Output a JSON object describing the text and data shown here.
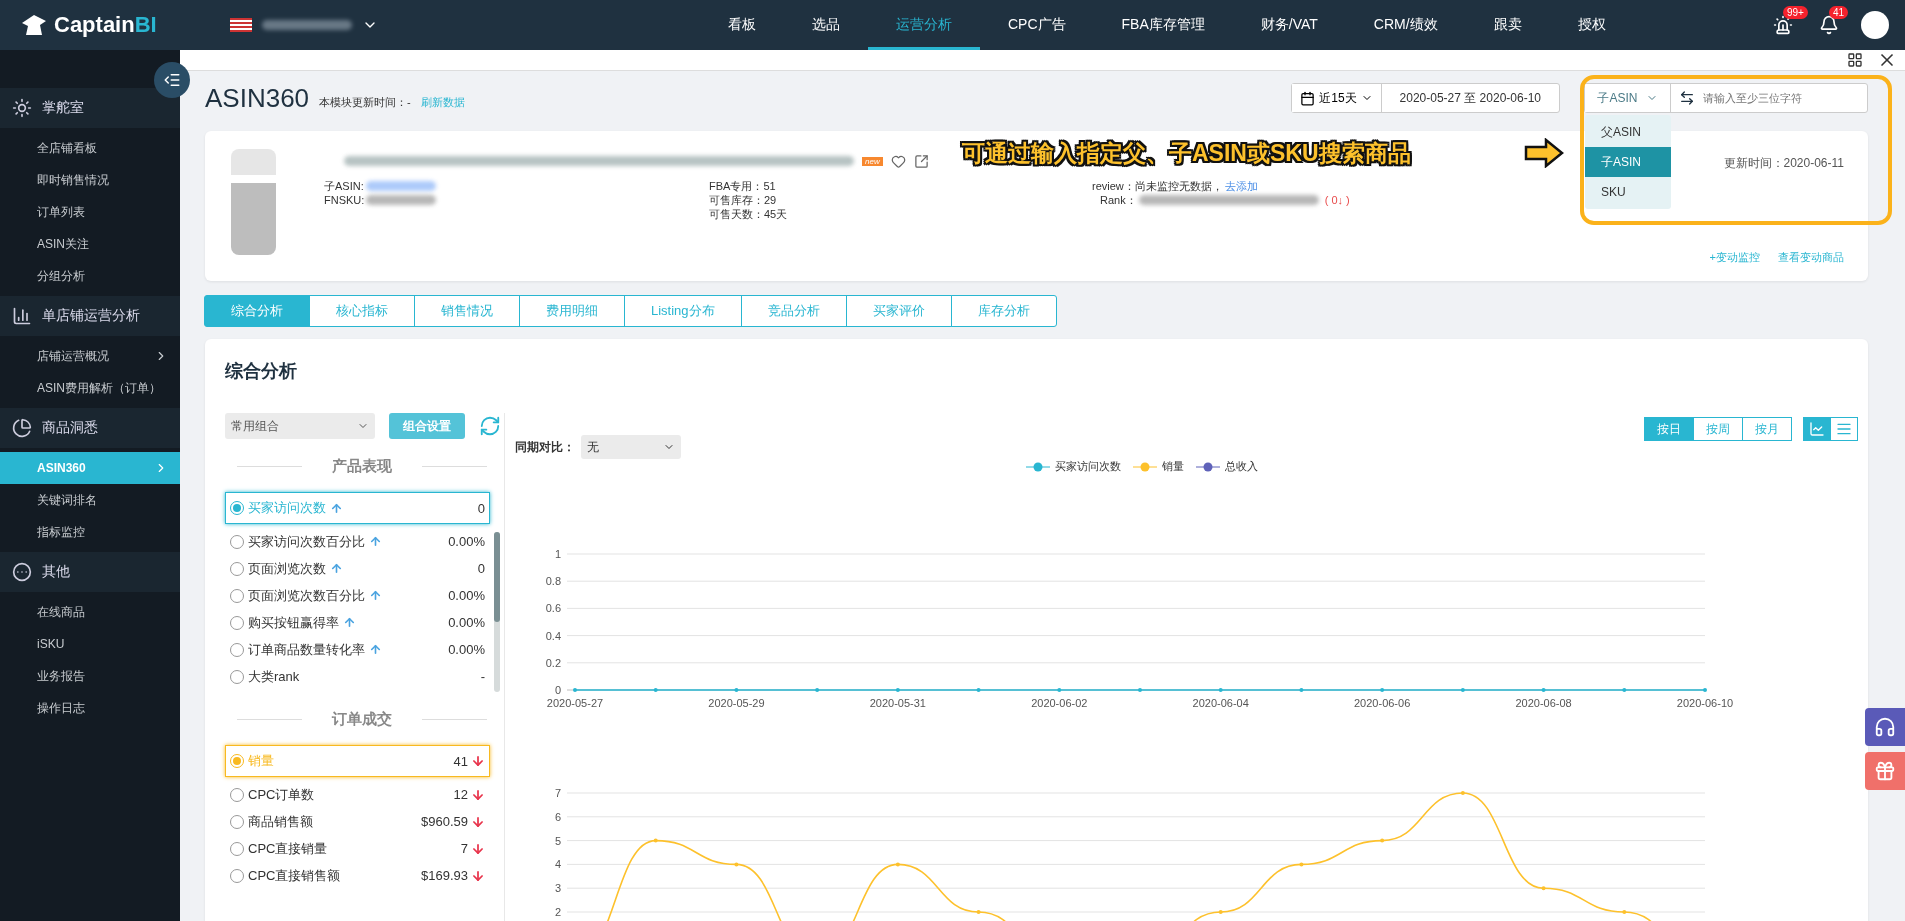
{
  "topbar": {
    "logo": {
      "text": "Captain",
      "accent": "BI"
    },
    "nav": [
      {
        "label": "看板",
        "selected": false
      },
      {
        "label": "选品",
        "selected": false
      },
      {
        "label": "运营分析",
        "selected": true
      },
      {
        "label": "CPC广告",
        "selected": false
      },
      {
        "label": "FBA库存管理",
        "selected": false
      },
      {
        "label": "财务/VAT",
        "selected": false
      },
      {
        "label": "CRM/绩效",
        "selected": false
      },
      {
        "label": "跟卖",
        "selected": false
      },
      {
        "label": "授权",
        "selected": false
      }
    ],
    "alert_badge": "99+",
    "bell_badge": "41"
  },
  "sidebar": {
    "groups": [
      {
        "title": "掌舵室",
        "items": [
          {
            "label": "全店铺看板",
            "selected": false,
            "arrow": false
          },
          {
            "label": "即时销售情况",
            "selected": false,
            "arrow": false
          },
          {
            "label": "订单列表",
            "selected": false,
            "arrow": false
          },
          {
            "label": "ASIN关注",
            "selected": false,
            "arrow": false
          },
          {
            "label": "分组分析",
            "selected": false,
            "arrow": false
          }
        ]
      },
      {
        "title": "单店铺运营分析",
        "items": [
          {
            "label": "店铺运营概况",
            "selected": false,
            "arrow": true
          },
          {
            "label": "ASIN费用解析（订单）",
            "selected": false,
            "arrow": false
          }
        ]
      },
      {
        "title": "商品洞悉",
        "items": [
          {
            "label": "ASIN360",
            "selected": true,
            "arrow": true
          },
          {
            "label": "关键词排名",
            "selected": false,
            "arrow": false
          },
          {
            "label": "指标监控",
            "selected": false,
            "arrow": false
          }
        ]
      },
      {
        "title": "其他",
        "items": [
          {
            "label": "在线商品",
            "selected": false,
            "arrow": false
          },
          {
            "label": "iSKU",
            "selected": false,
            "arrow": false
          },
          {
            "label": "业务报告",
            "selected": false,
            "arrow": false
          },
          {
            "label": "操作日志",
            "selected": false,
            "arrow": false
          }
        ]
      }
    ]
  },
  "page": {
    "title": "ASIN360",
    "update_label": "本模块更新时间：-",
    "refresh_link": "刷新数据"
  },
  "date_filter": {
    "range_button": "近15天",
    "range": "2020-05-27 至 2020-06-10"
  },
  "search": {
    "type": "子ASIN",
    "placeholder": "请输入至少三位字符",
    "options": [
      {
        "label": "父ASIN",
        "selected": false
      },
      {
        "label": "子ASIN",
        "selected": true
      },
      {
        "label": "SKU",
        "selected": false
      }
    ]
  },
  "annotation": {
    "text": "可通过输入指定父、子ASIN或SKU搜索商品"
  },
  "product": {
    "badge": "new",
    "id_labels": [
      "子ASIN:",
      "FNSKU:"
    ],
    "stock": [
      "FBA专用：51",
      "可售库存：29",
      "可售天数：45天"
    ],
    "review_label": "review：尚未监控无数据，",
    "review_link": "去添加",
    "rank_label": "Rank：",
    "rank_change": "( 0↓ )",
    "updated": "更新时间：2020-06-11",
    "links": [
      "+变动监控",
      "查看变动商品"
    ]
  },
  "tabs": [
    {
      "label": "综合分析",
      "selected": true
    },
    {
      "label": "核心指标",
      "selected": false
    },
    {
      "label": "销售情况",
      "selected": false
    },
    {
      "label": "费用明细",
      "selected": false
    },
    {
      "label": "Listing分布",
      "selected": false
    },
    {
      "label": "竞品分析",
      "selected": false
    },
    {
      "label": "买家评价",
      "selected": false
    },
    {
      "label": "库存分析",
      "selected": false
    }
  ],
  "analysis": {
    "title": "综合分析",
    "combo_select": "常用组合",
    "combo_button": "组合设置",
    "sections": [
      {
        "title": "产品表现",
        "kind": "performance",
        "metrics": [
          {
            "label": "买家访问次数",
            "value": "0",
            "selected": true,
            "kind": "up"
          },
          {
            "label": "买家访问次数百分比",
            "value": "0.00%",
            "selected": false,
            "kind": "up"
          },
          {
            "label": "页面浏览次数",
            "value": "0",
            "selected": false,
            "kind": "up"
          },
          {
            "label": "页面浏览次数百分比",
            "value": "0.00%",
            "selected": false,
            "kind": "up"
          },
          {
            "label": "购买按钮赢得率",
            "value": "0.00%",
            "selected": false,
            "kind": "up"
          },
          {
            "label": "订单商品数量转化率",
            "value": "0.00%",
            "selected": false,
            "kind": "up"
          },
          {
            "label": "大类rank",
            "value": "-",
            "selected": false,
            "kind": "plain"
          }
        ]
      },
      {
        "title": "订单成交",
        "kind": "orders",
        "metrics": [
          {
            "label": "销量",
            "value": "41",
            "selected": true,
            "kind": "down"
          },
          {
            "label": "CPC订单数",
            "value": "12",
            "selected": false,
            "kind": "down"
          },
          {
            "label": "商品销售额",
            "value": "$960.59",
            "selected": false,
            "kind": "down"
          },
          {
            "label": "CPC直接销量",
            "value": "7",
            "selected": false,
            "kind": "down"
          },
          {
            "label": "CPC直接销售额",
            "value": "$169.93",
            "selected": false,
            "kind": "down"
          }
        ]
      }
    ]
  },
  "chart_controls": {
    "compare_label": "同期对比：",
    "compare_value": "无",
    "periods": [
      {
        "label": "按日",
        "selected": true
      },
      {
        "label": "按周",
        "selected": false
      },
      {
        "label": "按月",
        "selected": false
      }
    ],
    "views": [
      {
        "kind": "line",
        "selected": true
      },
      {
        "kind": "table",
        "selected": false
      }
    ]
  },
  "legend_extra": [
    {
      "name": "总收入",
      "color": "#5f62b9"
    }
  ],
  "charts": [
    {
      "chart_data": {
        "type": "line",
        "grid": true,
        "categories": [
          "2020-05-27",
          null,
          "2020-05-29",
          null,
          "2020-05-31",
          null,
          "2020-06-02",
          null,
          "2020-06-04",
          null,
          "2020-06-06",
          null,
          "2020-06-08",
          null,
          "2020-06-10"
        ],
        "series": [
          {
            "name": "买家访问次数",
            "color": "#29b6d1",
            "values": [
              0,
              0,
              0,
              0,
              0,
              0,
              0,
              0,
              0,
              0,
              0,
              0,
              0,
              0,
              0
            ]
          }
        ],
        "ylim": [
          0,
          1
        ],
        "yticks": [
          0,
          0.2,
          0.4,
          0.6,
          0.8,
          1
        ]
      }
    },
    {
      "chart_data": {
        "type": "line",
        "grid": true,
        "categories": [
          null,
          null,
          null,
          null,
          null,
          null,
          null,
          null,
          null,
          null,
          null,
          null,
          null,
          null,
          null
        ],
        "series": [
          {
            "name": "销量",
            "color": "#fdc12c",
            "values": [
              null,
              5,
              4,
              null,
              4,
              2,
              null,
              null,
              2,
              4,
              5,
              7,
              3,
              2,
              null
            ]
          }
        ],
        "ylim": [
          2,
          7
        ],
        "yticks": [
          2,
          3,
          4,
          5,
          6,
          7
        ]
      }
    }
  ]
}
